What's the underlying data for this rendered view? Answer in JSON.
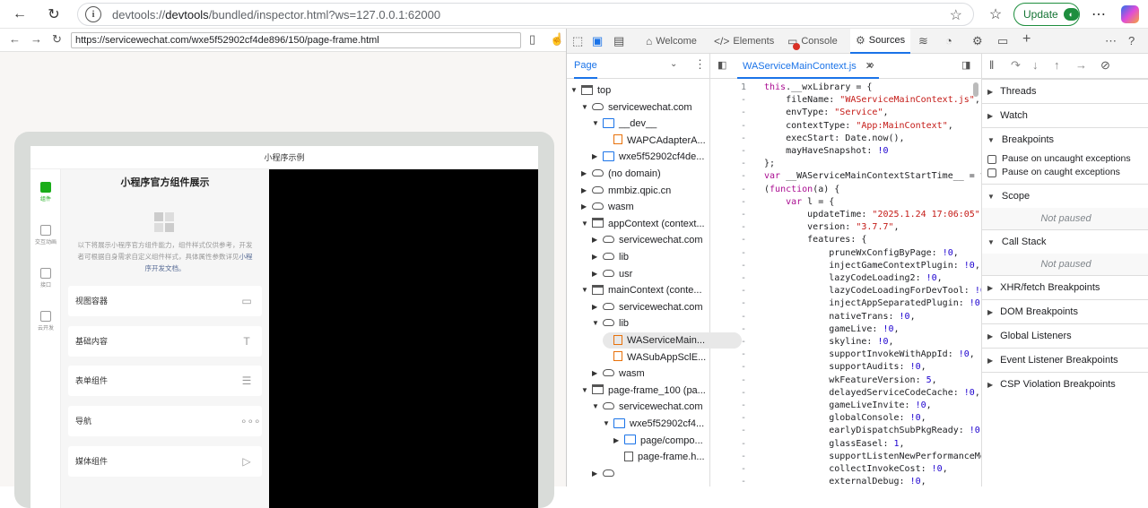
{
  "browser": {
    "url_prefix": "devtools://",
    "url_host": "devtools",
    "url_rest": "/bundled/inspector.html?ws=127.0.0.1:62000",
    "update_label": "Update"
  },
  "inner_browser": {
    "url": "https://servicewechat.com/wxe5f52902cf4de896/150/page-frame.html"
  },
  "miniprogram": {
    "title": "小程序示例",
    "heading": "小程序官方组件展示",
    "description": "以下将展示小程序官方组件能力，组件样式仅供参考，开发者可根据自身需求自定义组件样式，具体属性参数详见",
    "description_link": "小程序开发文档。",
    "sidebar": [
      {
        "label": "组件"
      },
      {
        "label": "交互动画"
      },
      {
        "label": "接口"
      },
      {
        "label": "云开发"
      }
    ],
    "menu": [
      {
        "label": "视图容器",
        "icon": "▭"
      },
      {
        "label": "基础内容",
        "icon": "T"
      },
      {
        "label": "表单组件",
        "icon": "☰"
      },
      {
        "label": "导航",
        "icon": "∘∘∘"
      },
      {
        "label": "媒体组件",
        "icon": "▷"
      }
    ]
  },
  "devtools": {
    "tabs": [
      {
        "label": "Welcome",
        "glyph": "⌂"
      },
      {
        "label": "Elements",
        "glyph": "</>"
      },
      {
        "label": "Console",
        "glyph": "▭"
      },
      {
        "label": "Sources",
        "glyph": "⚙"
      }
    ],
    "navigator_tab": "Page",
    "editor_file": "WAServiceMainContext.js",
    "tree": [
      {
        "label": "top",
        "icon": "frame",
        "arrow": "▼",
        "depth": 0
      },
      {
        "label": "servicewechat.com",
        "icon": "cloud",
        "arrow": "▼",
        "depth": 1
      },
      {
        "label": "__dev__",
        "icon": "folder",
        "arrow": "▼",
        "depth": 2
      },
      {
        "label": "WAPCAdapterA...",
        "icon": "filejs",
        "arrow": "",
        "depth": 3
      },
      {
        "label": "wxe5f52902cf4de...",
        "icon": "folder",
        "arrow": "▶",
        "depth": 2
      },
      {
        "label": "(no domain)",
        "icon": "cloud",
        "arrow": "▶",
        "depth": 1
      },
      {
        "label": "mmbiz.qpic.cn",
        "icon": "cloud",
        "arrow": "▶",
        "depth": 1
      },
      {
        "label": "wasm",
        "icon": "cloud",
        "arrow": "▶",
        "depth": 1
      },
      {
        "label": "appContext (context...",
        "icon": "frame",
        "arrow": "▼",
        "depth": 1
      },
      {
        "label": "servicewechat.com",
        "icon": "cloud",
        "arrow": "▶",
        "depth": 2
      },
      {
        "label": "lib",
        "icon": "cloud",
        "arrow": "▶",
        "depth": 2
      },
      {
        "label": "usr",
        "icon": "cloud",
        "arrow": "▶",
        "depth": 2
      },
      {
        "label": "mainContext (conte...",
        "icon": "frame",
        "arrow": "▼",
        "depth": 1
      },
      {
        "label": "servicewechat.com",
        "icon": "cloud",
        "arrow": "▶",
        "depth": 2
      },
      {
        "label": "lib",
        "icon": "cloud",
        "arrow": "▼",
        "depth": 2
      },
      {
        "label": "WAServiceMain...",
        "icon": "filejs",
        "arrow": "",
        "depth": 3
      },
      {
        "label": "WASubAppSclE...",
        "icon": "filejs",
        "arrow": "",
        "depth": 3
      },
      {
        "label": "wasm",
        "icon": "cloud",
        "arrow": "▶",
        "depth": 2
      },
      {
        "label": "page-frame_100 (pa...",
        "icon": "frame",
        "arrow": "▼",
        "depth": 1
      },
      {
        "label": "servicewechat.com",
        "icon": "cloud",
        "arrow": "▼",
        "depth": 2
      },
      {
        "label": "wxe5f52902cf4...",
        "icon": "folder",
        "arrow": "▼",
        "depth": 3
      },
      {
        "label": "page/compo...",
        "icon": "folder",
        "arrow": "▶",
        "depth": 4
      },
      {
        "label": "page-frame.h...",
        "icon": "file",
        "arrow": "",
        "depth": 4
      },
      {
        "label": "",
        "icon": "cloud",
        "arrow": "▶",
        "depth": 2
      }
    ],
    "code": [
      {
        "n": "1",
        "t": "this.__wxLibrary = {"
      },
      {
        "n": "-",
        "t": "    fileName: \"WAServiceMainContext.js\","
      },
      {
        "n": "-",
        "t": "    envType: \"Service\","
      },
      {
        "n": "-",
        "t": "    contextType: \"App:MainContext\","
      },
      {
        "n": "-",
        "t": "    execStart: Date.now(),"
      },
      {
        "n": "-",
        "t": "    mayHaveSnapshot: !0"
      },
      {
        "n": "-",
        "t": "};"
      },
      {
        "n": "-",
        "t": "var __WAServiceMainContextStartTime__ = t"
      },
      {
        "n": "-",
        "t": "(function(a) {"
      },
      {
        "n": "-",
        "t": "    var l = {"
      },
      {
        "n": "-",
        "t": "        updateTime: \"2025.1.24 17:06:05\","
      },
      {
        "n": "-",
        "t": "        version: \"3.7.7\","
      },
      {
        "n": "-",
        "t": "        features: {"
      },
      {
        "n": "-",
        "t": "            pruneWxConfigByPage: !0,"
      },
      {
        "n": "-",
        "t": "            injectGameContextPlugin: !0,"
      },
      {
        "n": "-",
        "t": "            lazyCodeLoading2: !0,"
      },
      {
        "n": "-",
        "t": "            lazyCodeLoadingForDevTool: !0"
      },
      {
        "n": "-",
        "t": "            injectAppSeparatedPlugin: !0,"
      },
      {
        "n": "-",
        "t": "            nativeTrans: !0,"
      },
      {
        "n": "-",
        "t": "            gameLive: !0,"
      },
      {
        "n": "-",
        "t": "            skyline: !0,"
      },
      {
        "n": "-",
        "t": "            supportInvokeWithAppId: !0,"
      },
      {
        "n": "-",
        "t": "            supportAudits: !0,"
      },
      {
        "n": "-",
        "t": "            wkFeatureVersion: 5,"
      },
      {
        "n": "-",
        "t": "            delayedServiceCodeCache: !0,"
      },
      {
        "n": "-",
        "t": "            gameLiveInvite: !0,"
      },
      {
        "n": "-",
        "t": "            globalConsole: !0,"
      },
      {
        "n": "-",
        "t": "            earlyDispatchSubPkgReady: !0,"
      },
      {
        "n": "-",
        "t": "            glassEasel: 1,"
      },
      {
        "n": "-",
        "t": "            supportListenNewPerformanceMe"
      },
      {
        "n": "-",
        "t": "            collectInvokeCost: !0,"
      },
      {
        "n": "-",
        "t": "            externalDebug: !0,"
      }
    ],
    "debugger": {
      "threads": "Threads",
      "watch": "Watch",
      "breakpoints": "Breakpoints",
      "pause_uncaught": "Pause on uncaught exceptions",
      "pause_caught": "Pause on caught exceptions",
      "scope": "Scope",
      "not_paused_1": "Not paused",
      "call_stack": "Call Stack",
      "not_paused_2": "Not paused",
      "xhr": "XHR/fetch Breakpoints",
      "dom": "DOM Breakpoints",
      "global": "Global Listeners",
      "event": "Event Listener Breakpoints",
      "csp": "CSP Violation Breakpoints"
    }
  }
}
